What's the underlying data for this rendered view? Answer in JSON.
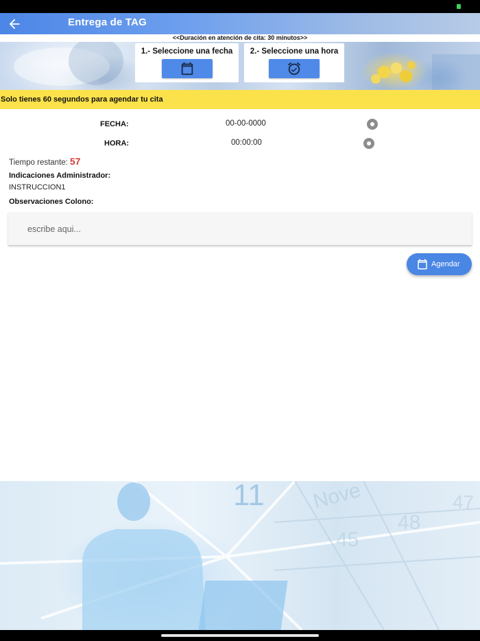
{
  "header": {
    "title": "Entrega de TAG",
    "duration_note": "<<Duración en atención de cita: 30 minutos>>"
  },
  "pickers": {
    "date_label": "1.- Seleccione una fecha",
    "time_label": "2.- Seleccione una hora"
  },
  "warning": "Solo tienes 60 segundos para agendar tu cita",
  "fields": {
    "fecha_label": "FECHA:",
    "fecha_value": "00-00-0000",
    "hora_label": "HORA:",
    "hora_value": "00:00:00"
  },
  "timer": {
    "label": "Tiempo restante:",
    "value": "57"
  },
  "admin": {
    "label": "Indicaciones Administrador:",
    "value": "INSTRUCCION1"
  },
  "observations": {
    "label": "Observaciones Colono:",
    "placeholder": "escribe aqui...",
    "value": ""
  },
  "actions": {
    "agendar_label": "Agendar"
  },
  "colors": {
    "primary": "#4a86e3",
    "warning_bg": "#fbe24b",
    "countdown": "#d43a3a"
  }
}
